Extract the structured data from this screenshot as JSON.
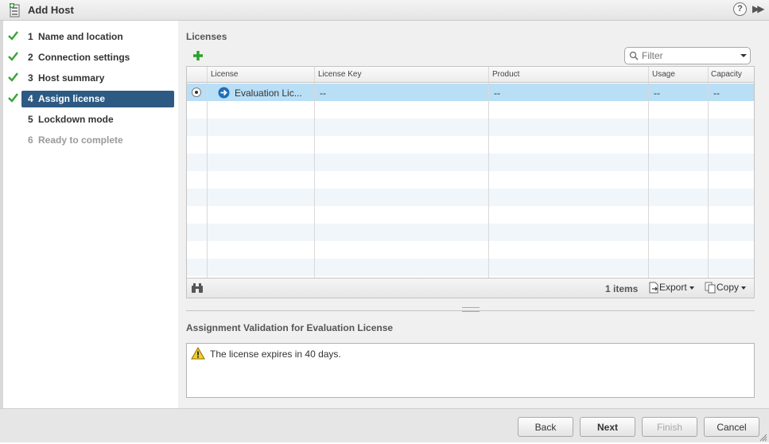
{
  "window": {
    "title": "Add Host",
    "help_label": "?"
  },
  "steps": [
    {
      "num": "1",
      "label": "Name and location",
      "state": "done"
    },
    {
      "num": "2",
      "label": "Connection settings",
      "state": "done"
    },
    {
      "num": "3",
      "label": "Host summary",
      "state": "done"
    },
    {
      "num": "4",
      "label": "Assign license",
      "state": "active"
    },
    {
      "num": "5",
      "label": "Lockdown mode",
      "state": "pending"
    },
    {
      "num": "6",
      "label": "Ready to complete",
      "state": "disabled"
    }
  ],
  "licenses": {
    "title": "Licenses",
    "filter_placeholder": "Filter",
    "columns": [
      "License",
      "License Key",
      "Product",
      "Usage",
      "Capacity"
    ],
    "rows": [
      {
        "license": "Evaluation Lic...",
        "license_key": "--",
        "product": "--",
        "usage": "--",
        "capacity": "--",
        "selected": true
      }
    ],
    "footer": {
      "count": "1 items",
      "export_label": "Export",
      "copy_label": "Copy"
    }
  },
  "validation": {
    "title": "Assignment Validation for Evaluation License",
    "message": "The license expires in 40 days."
  },
  "buttons": {
    "back": "Back",
    "next": "Next",
    "finish": "Finish",
    "cancel": "Cancel"
  },
  "colors": {
    "active_step": "#2d5a82",
    "selected_row": "#b9dff7",
    "check": "#3aa23a",
    "add": "#2aa22a"
  }
}
